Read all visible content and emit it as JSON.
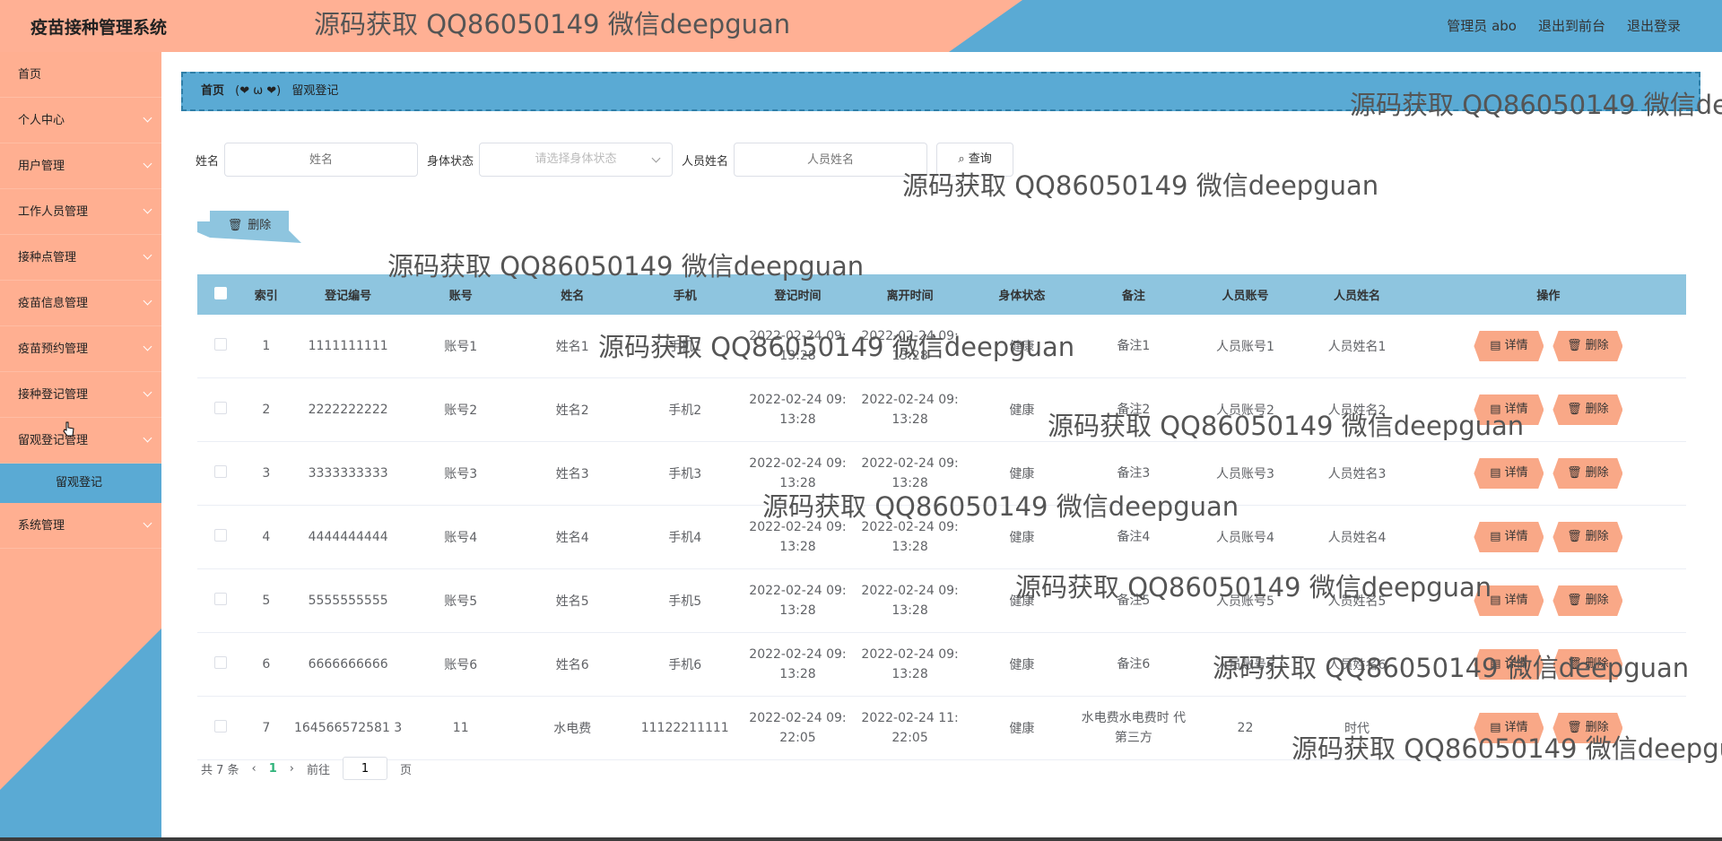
{
  "header": {
    "app_title": "疫苗接种管理系统",
    "admin_label": "管理员 abo",
    "to_front": "退出到前台",
    "logout": "退出登录"
  },
  "sidebar": {
    "items": [
      {
        "label": "首页"
      },
      {
        "label": "个人中心"
      },
      {
        "label": "用户管理"
      },
      {
        "label": "工作人员管理"
      },
      {
        "label": "接种点管理"
      },
      {
        "label": "疫苗信息管理"
      },
      {
        "label": "疫苗预约管理"
      },
      {
        "label": "接种登记管理"
      },
      {
        "label": "留观登记管理"
      }
    ],
    "sub_item": "留观登记",
    "last_item": "系统管理"
  },
  "breadcrumb": {
    "home": "首页",
    "separator": "(❤ ω ❤)",
    "current": "留观登记"
  },
  "search": {
    "name_label": "姓名",
    "name_placeholder": "姓名",
    "status_label": "身体状态",
    "status_placeholder": "请选择身体状态",
    "staff_label": "人员姓名",
    "staff_placeholder": "人员姓名",
    "query_label": "查询"
  },
  "actions": {
    "delete_label": "删除"
  },
  "table": {
    "columns": [
      "索引",
      "登记编号",
      "账号",
      "姓名",
      "手机",
      "登记时间",
      "离开时间",
      "身体状态",
      "备注",
      "人员账号",
      "人员姓名",
      "操作"
    ],
    "detail_label": "详情",
    "delete_label": "删除",
    "rows": [
      {
        "idx": "1",
        "code": "1111111111",
        "account": "账号1",
        "name": "姓名1",
        "phone": "手机1",
        "reg_d": "2022-02-24 09:",
        "reg_t": "13:28",
        "leave_d": "2022-02-24 09:",
        "leave_t": "13:28",
        "status": "健康",
        "note": "备注1",
        "staff_acc": "人员账号1",
        "staff_name": "人员姓名1"
      },
      {
        "idx": "2",
        "code": "2222222222",
        "account": "账号2",
        "name": "姓名2",
        "phone": "手机2",
        "reg_d": "2022-02-24 09:",
        "reg_t": "13:28",
        "leave_d": "2022-02-24 09:",
        "leave_t": "13:28",
        "status": "健康",
        "note": "备注2",
        "staff_acc": "人员账号2",
        "staff_name": "人员姓名2"
      },
      {
        "idx": "3",
        "code": "3333333333",
        "account": "账号3",
        "name": "姓名3",
        "phone": "手机3",
        "reg_d": "2022-02-24 09:",
        "reg_t": "13:28",
        "leave_d": "2022-02-24 09:",
        "leave_t": "13:28",
        "status": "健康",
        "note": "备注3",
        "staff_acc": "人员账号3",
        "staff_name": "人员姓名3"
      },
      {
        "idx": "4",
        "code": "4444444444",
        "account": "账号4",
        "name": "姓名4",
        "phone": "手机4",
        "reg_d": "2022-02-24 09:",
        "reg_t": "13:28",
        "leave_d": "2022-02-24 09:",
        "leave_t": "13:28",
        "status": "健康",
        "note": "备注4",
        "staff_acc": "人员账号4",
        "staff_name": "人员姓名4"
      },
      {
        "idx": "5",
        "code": "5555555555",
        "account": "账号5",
        "name": "姓名5",
        "phone": "手机5",
        "reg_d": "2022-02-24 09:",
        "reg_t": "13:28",
        "leave_d": "2022-02-24 09:",
        "leave_t": "13:28",
        "status": "健康",
        "note": "备注5",
        "staff_acc": "人员账号5",
        "staff_name": "人员姓名5"
      },
      {
        "idx": "6",
        "code": "6666666666",
        "account": "账号6",
        "name": "姓名6",
        "phone": "手机6",
        "reg_d": "2022-02-24 09:",
        "reg_t": "13:28",
        "leave_d": "2022-02-24 09:",
        "leave_t": "13:28",
        "status": "健康",
        "note": "备注6",
        "staff_acc": "人员账号6",
        "staff_name": "人员姓名6"
      },
      {
        "idx": "7",
        "code": "164566572581 3",
        "account": "11",
        "name": "水电费",
        "phone": "11122211111",
        "reg_d": "2022-02-24 09:",
        "reg_t": "22:05",
        "leave_d": "2022-02-24 11:",
        "leave_t": "22:05",
        "status": "健康",
        "note": "水电费水电费时 代第三方",
        "staff_acc": "22",
        "staff_name": "时代"
      }
    ]
  },
  "pagination": {
    "total": "共 7 条",
    "prev": "‹",
    "current": "1",
    "next": "›",
    "goto": "前往",
    "page_value": "1",
    "page_unit": "页"
  },
  "watermark": "源码获取 QQ86050149 微信deepguan",
  "colors": {
    "salmon": "#ffb094",
    "blue": "#5aaad4",
    "header_table": "#8ec5df",
    "op_button": "#f9a887"
  }
}
